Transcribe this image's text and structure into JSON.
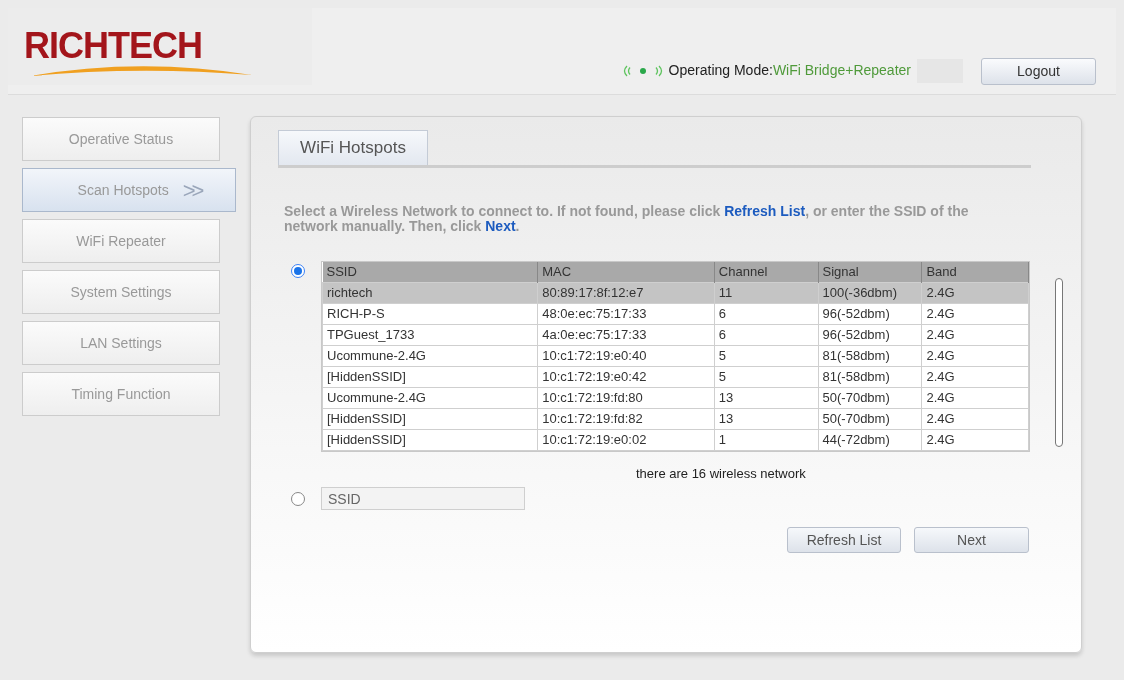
{
  "header": {
    "logo": "RICHTECH",
    "mode_label": "Operating Mode:",
    "mode_value": "WiFi Bridge+Repeater",
    "logout": "Logout"
  },
  "sidebar": {
    "items": [
      {
        "label": "Operative Status",
        "selected": false
      },
      {
        "label": "Scan Hotspots",
        "selected": true,
        "arrow": ">>"
      },
      {
        "label": "WiFi Repeater",
        "selected": false
      },
      {
        "label": "System Settings",
        "selected": false
      },
      {
        "label": "LAN Settings",
        "selected": false
      },
      {
        "label": "Timing Function",
        "selected": false
      }
    ]
  },
  "tabs": [
    {
      "label": "WiFi Hotspots",
      "selected": true
    }
  ],
  "instructions": "Select a Wireless Network to connect to. If not found, please click **Refresh List**, or enter the SSID of the network manually. Then, click **Next**.",
  "options": [
    {
      "kind": "list",
      "selected": true
    },
    {
      "kind": "manual",
      "selected": false,
      "placeholder": "SSID"
    }
  ],
  "table": {
    "columns": [
      "SSID",
      "MAC",
      "Channel",
      "Signal",
      "Band"
    ],
    "rows": [
      {
        "cells": [
          "richtech",
          "80:89:17:8f:12:e7",
          "11",
          "100(-36dbm)",
          "2.4G"
        ],
        "selected": true
      },
      {
        "cells": [
          "RICH-P-S",
          "48:0e:ec:75:17:33",
          "6",
          "96(-52dbm)",
          "2.4G"
        ],
        "selected": false
      },
      {
        "cells": [
          "TPGuest_1733",
          "4a:0e:ec:75:17:33",
          "6",
          "96(-52dbm)",
          "2.4G"
        ],
        "selected": false
      },
      {
        "cells": [
          "Ucommune-2.4G",
          "10:c1:72:19:e0:40",
          "5",
          "81(-58dbm)",
          "2.4G"
        ],
        "selected": false
      },
      {
        "cells": [
          "[HiddenSSID]",
          "10:c1:72:19:e0:42",
          "5",
          "81(-58dbm)",
          "2.4G"
        ],
        "selected": false
      },
      {
        "cells": [
          "Ucommune-2.4G",
          "10:c1:72:19:fd:80",
          "13",
          "50(-70dbm)",
          "2.4G"
        ],
        "selected": false
      },
      {
        "cells": [
          "[HiddenSSID]",
          "10:c1:72:19:fd:82",
          "13",
          "50(-70dbm)",
          "2.4G"
        ],
        "selected": false
      },
      {
        "cells": [
          "[HiddenSSID]",
          "10:c1:72:19:e0:02",
          "1",
          "44(-72dbm)",
          "2.4G"
        ],
        "selected": false
      }
    ]
  },
  "count_text": "there are 16 wireless network",
  "buttons": [
    "Refresh List",
    "Next"
  ]
}
